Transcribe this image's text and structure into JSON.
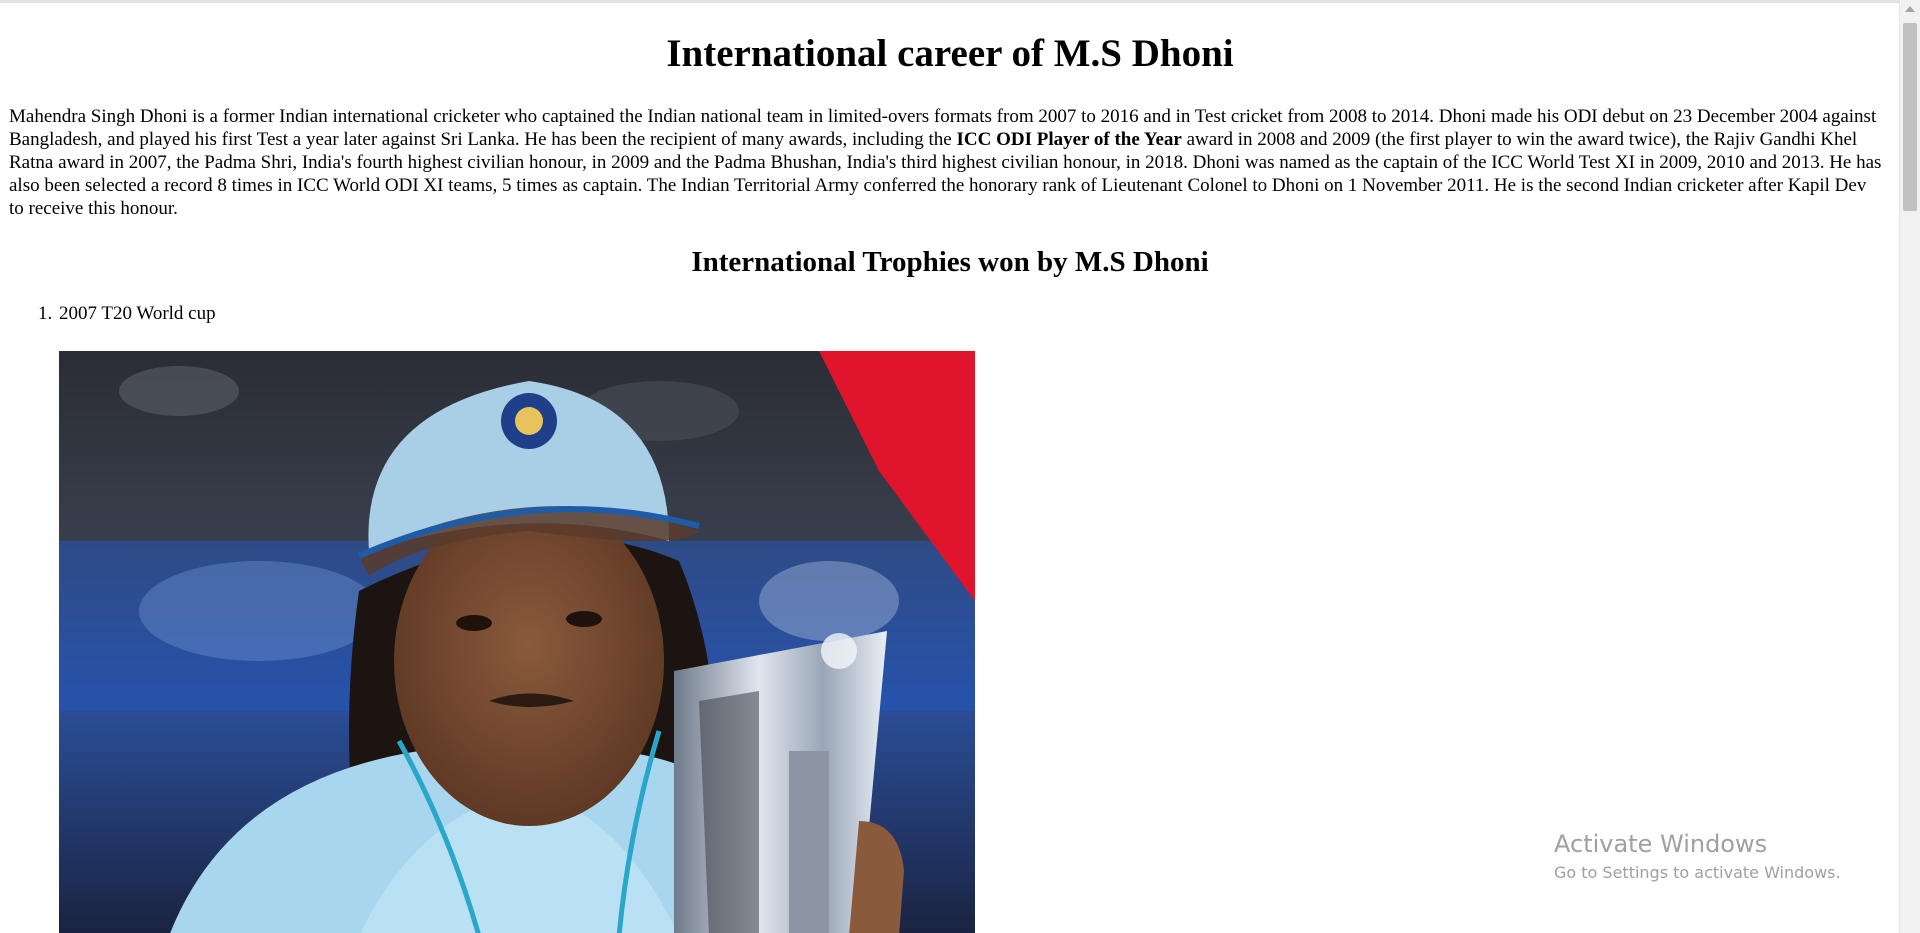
{
  "page": {
    "title": "International career of M.S Dhoni",
    "intro_parts": {
      "before_bold": "Mahendra Singh Dhoni is a former Indian international cricketer who captained the Indian national team in limited-overs formats from 2007 to 2016 and in Test cricket from 2008 to 2014. Dhoni made his ODI debut on 23 December 2004 against Bangladesh, and played his first Test a year later against Sri Lanka. He has been the recipient of many awards, including the ",
      "bold": "ICC ODI Player of the Year",
      "after_bold": " award in 2008 and 2009 (the first player to win the award twice), the Rajiv Gandhi Khel Ratna award in 2007, the Padma Shri, India's fourth highest civilian honour, in 2009 and the Padma Bhushan, India's third highest civilian honour, in 2018. Dhoni was named as the captain of the ICC World Test XI in 2009, 2010 and 2013. He has also been selected a record 8 times in ICC World ODI XI teams, 5 times as captain. The Indian Territorial Army conferred the honorary rank of Lieutenant Colonel to Dhoni on 1 November 2011. He is the second Indian cricketer after Kapil Dev to receive this honour."
    },
    "subtitle": "International Trophies won by M.S Dhoni",
    "trophies": [
      {
        "number": "1.",
        "label": "2007 T20 World cup"
      }
    ]
  },
  "watermark": {
    "title": "Activate Windows",
    "subtitle": "Go to Settings to activate Windows."
  },
  "colors": {
    "cap": "#a9cfe6",
    "jersey": "#9fd0ea",
    "stadium_blue": "#1e3f8f",
    "red_banner": "#e0142b"
  }
}
